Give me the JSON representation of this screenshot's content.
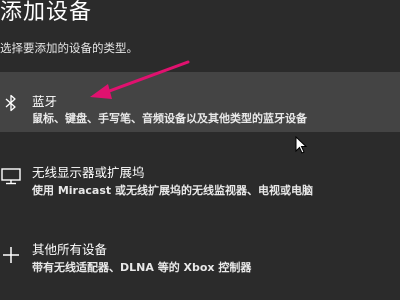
{
  "dialog": {
    "title": "添加设备",
    "subtitle": "选择要添加的设备的类型。"
  },
  "options": [
    {
      "icon": "bluetooth-icon",
      "title": "蓝牙",
      "description": "鼠标、键盘、手写笔、音频设备以及其他类型的蓝牙设备",
      "selected": true
    },
    {
      "icon": "monitor-icon",
      "title": "无线显示器或扩展坞",
      "description": "使用 Miracast 或无线扩展坞的无线监视器、电视或电脑",
      "selected": false
    },
    {
      "icon": "plus-icon",
      "title": "其他所有设备",
      "description": "带有无线适配器、DLNA 等的 Xbox 控制器",
      "selected": false
    }
  ],
  "colors": {
    "background": "#2b2b2b",
    "selected_row": "#444444",
    "annotation_arrow": "#e0116f"
  }
}
